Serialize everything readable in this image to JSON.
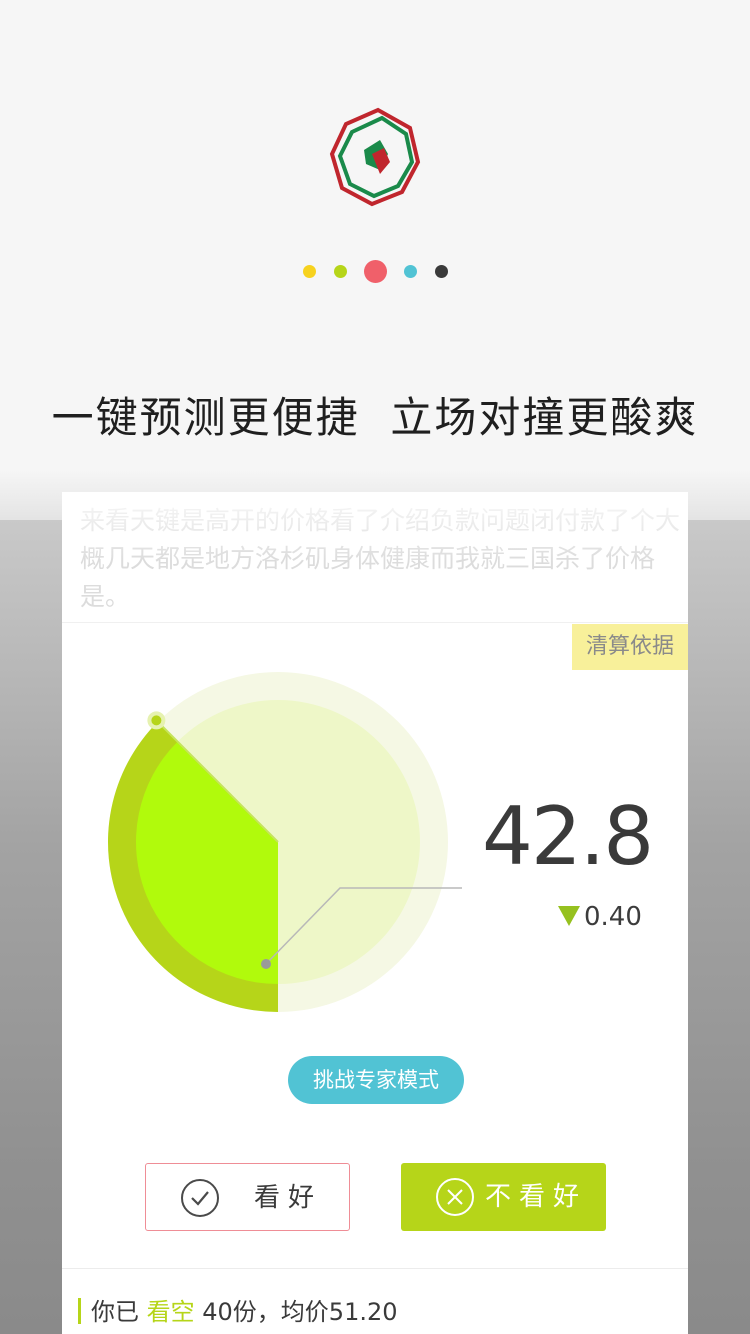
{
  "onboarding": {
    "logo_name": "app-logo",
    "pager": {
      "active_index": 2,
      "dot_colors": [
        "#f7d21e",
        "#b6d519",
        "#f0606a",
        "#51c3d4",
        "#3a3a3a"
      ]
    },
    "headline": "一键预测更便捷  立场对撞更酸爽"
  },
  "card": {
    "description": "来看天键是高开的价格看了介绍负款问题闭付款了个大概几天都是地方洛杉矶身体健康而我就三国杀了价格是。",
    "basis_tag": "清算依据",
    "gauge": {
      "fill_fraction": 0.375,
      "colors": {
        "fill": "#b1fa0c",
        "ring": "#b6d519",
        "base": "#eef7c8",
        "halo": "#f5f8e4"
      }
    },
    "value": "42.8",
    "change": "0.40",
    "expert_button": "挑战专家模式",
    "good_button": "看好",
    "bad_button": "不看好",
    "footer": {
      "prefix": "你已 ",
      "stance": "看空",
      "suffix": " 40份，均价51.20"
    }
  }
}
